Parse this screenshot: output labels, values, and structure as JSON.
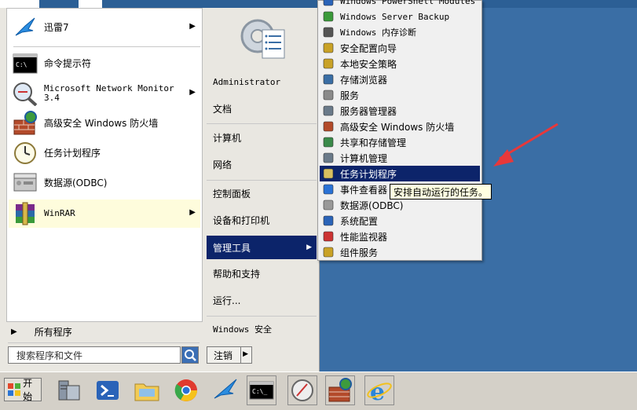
{
  "start_menu": {
    "left_items": [
      {
        "label": "迅雷7",
        "has_arrow": true
      },
      {
        "label": "命令提示符",
        "has_arrow": false
      },
      {
        "label": "Microsoft Network Monitor\n3.4",
        "has_arrow": true
      },
      {
        "label": "高级安全 Windows 防火墙",
        "has_arrow": false
      },
      {
        "label": "任务计划程序",
        "has_arrow": false
      },
      {
        "label": "数据源(ODBC)",
        "has_arrow": false
      },
      {
        "label": "WinRAR",
        "has_arrow": true
      }
    ],
    "all_programs": "所有程序",
    "search_placeholder": "搜索程序和文件",
    "right_items": [
      {
        "label": "Administrator"
      },
      {
        "label": "文档"
      },
      {
        "label": "计算机"
      },
      {
        "label": "网络"
      },
      {
        "label": "控制面板"
      },
      {
        "label": "设备和打印机"
      },
      {
        "label": "管理工具"
      },
      {
        "label": "帮助和支持"
      },
      {
        "label": "运行..."
      },
      {
        "label": "Windows 安全"
      }
    ],
    "logoff_label": "注销"
  },
  "submenu": {
    "items": [
      {
        "label": "Windows PowerShell Modules",
        "icon": "powershell-icon"
      },
      {
        "label": "Windows Server Backup",
        "icon": "backup-icon"
      },
      {
        "label": "Windows 内存诊断",
        "icon": "memory-chip-icon"
      },
      {
        "label": "安全配置向导",
        "icon": "security-wizard-icon"
      },
      {
        "label": "本地安全策略",
        "icon": "security-policy-icon"
      },
      {
        "label": "存储浏览器",
        "icon": "storage-icon"
      },
      {
        "label": "服务",
        "icon": "services-gear-icon"
      },
      {
        "label": "服务器管理器",
        "icon": "server-manager-icon"
      },
      {
        "label": "高级安全 Windows 防火墙",
        "icon": "firewall-icon"
      },
      {
        "label": "共享和存储管理",
        "icon": "share-storage-icon"
      },
      {
        "label": "计算机管理",
        "icon": "computer-management-icon"
      },
      {
        "label": "任务计划程序",
        "icon": "clock-icon"
      },
      {
        "label": "事件查看器",
        "icon": "event-viewer-icon"
      },
      {
        "label": "数据源(ODBC)",
        "icon": "database-icon"
      },
      {
        "label": "系统配置",
        "icon": "system-config-icon"
      },
      {
        "label": "性能监视器",
        "icon": "performance-monitor-icon"
      },
      {
        "label": "组件服务",
        "icon": "component-services-icon"
      }
    ],
    "tooltip": "安排自动运行的任务。"
  },
  "taskbar": {
    "start_label": "开始",
    "icons": [
      "server-manager-icon",
      "powershell-icon",
      "explorer-folder-icon",
      "chrome-icon",
      "thunder-bird-icon",
      "cmd-icon",
      "network-monitor-icon",
      "firewall-icon",
      "internet-explorer-icon"
    ]
  },
  "colors": {
    "desktop": "#3a6ea5",
    "highlight": "#0c246a",
    "annotation_arrow": "#e8383a"
  }
}
